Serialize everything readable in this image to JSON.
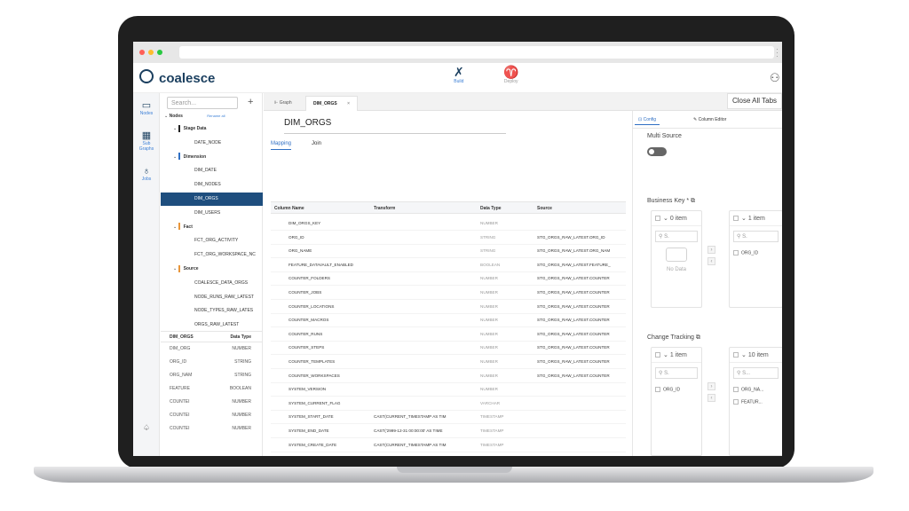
{
  "app": {
    "name": "coalesce"
  },
  "modes": [
    {
      "label": "Build",
      "icon": "build-icon"
    },
    {
      "label": "Deploy",
      "icon": "deploy-icon"
    }
  ],
  "rail": [
    {
      "label": "Nodes"
    },
    {
      "label": "Subgraphs",
      "label_line1": "Sub",
      "label_line2": "Graphs"
    },
    {
      "label": "Jobs"
    }
  ],
  "tree": {
    "search_placeholder": "Search...",
    "header": "Nodes",
    "header_hint": "Rename all",
    "items": [
      {
        "label": "Stage Data",
        "type": "group",
        "color": "#222222"
      },
      {
        "label": "DATE_NODE",
        "type": "node"
      },
      {
        "label": "Dimension",
        "type": "group",
        "color": "#2f6fc4"
      },
      {
        "label": "DIM_DATE",
        "type": "node"
      },
      {
        "label": "DIM_NODES",
        "type": "node"
      },
      {
        "label": "DIM_ORGS",
        "type": "node",
        "selected": true
      },
      {
        "label": "DIM_USERS",
        "type": "node"
      },
      {
        "label": "Fact",
        "type": "group",
        "color": "#e8963a"
      },
      {
        "label": "FCT_ORG_ACTIVITY",
        "type": "node"
      },
      {
        "label": "FCT_ORG_WORKSPACE_NC",
        "type": "node"
      },
      {
        "label": "Source",
        "type": "group",
        "color": "#e8963a"
      },
      {
        "label": "COALESCE_DATA_ORGS",
        "type": "node"
      },
      {
        "label": "NODE_RUNS_RAW_LATEST",
        "type": "node"
      },
      {
        "label": "NODE_TYPES_RAW_LATES",
        "type": "node"
      },
      {
        "label": "ORGS_RAW_LATEST",
        "type": "node"
      }
    ]
  },
  "mini_table": {
    "headers": [
      "DIM_ORGS",
      "Data Type"
    ],
    "rows": [
      [
        "DIM_ORG",
        "NUMBER"
      ],
      [
        "ORG_ID",
        "STRING"
      ],
      [
        "ORG_NAM",
        "STRING"
      ],
      [
        "FEATURE",
        "BOOLEAN"
      ],
      [
        "COUNTEI",
        "NUMBER"
      ],
      [
        "COUNTEI",
        "NUMBER"
      ],
      [
        "COUNTEI",
        "NUMBER"
      ]
    ]
  },
  "tabs": [
    {
      "label": "Graph"
    },
    {
      "label": "DIM_ORGS",
      "active": true,
      "close": "×"
    }
  ],
  "close_all_label": "Close All Tabs",
  "node": {
    "title": "DIM_ORGS"
  },
  "subtabs": [
    {
      "label": "Mapping",
      "active": true
    },
    {
      "label": "Join"
    }
  ],
  "grid": {
    "headers": [
      "Column Name",
      "Transform",
      "Data Type",
      "Source"
    ],
    "rows": [
      [
        "DIM_ORGS_KEY",
        "",
        "NUMBER",
        ""
      ],
      [
        "ORG_ID",
        "",
        "STRING",
        "STG_ORGS_RAW_LATEST.ORG_ID"
      ],
      [
        "ORG_NAME",
        "",
        "STRING",
        "STG_ORGS_RAW_LATEST.ORG_NAM"
      ],
      [
        "FEATURE_DATAVAULT_ENABLED",
        "",
        "BOOLEAN",
        "STG_ORGS_RAW_LATEST.FEATURE_"
      ],
      [
        "COUNTER_FOLDERS",
        "",
        "NUMBER",
        "STG_ORGS_RAW_LATEST.COUNTER"
      ],
      [
        "COUNTER_JOBS",
        "",
        "NUMBER",
        "STG_ORGS_RAW_LATEST.COUNTER"
      ],
      [
        "COUNTER_LOCATIONS",
        "",
        "NUMBER",
        "STG_ORGS_RAW_LATEST.COUNTER"
      ],
      [
        "COUNTER_MACROS",
        "",
        "NUMBER",
        "STG_ORGS_RAW_LATEST.COUNTER"
      ],
      [
        "COUNTER_RUNS",
        "",
        "NUMBER",
        "STG_ORGS_RAW_LATEST.COUNTER"
      ],
      [
        "COUNTER_STEPS",
        "",
        "NUMBER",
        "STG_ORGS_RAW_LATEST.COUNTER"
      ],
      [
        "COUNTER_TEMPLATES",
        "",
        "NUMBER",
        "STG_ORGS_RAW_LATEST.COUNTER"
      ],
      [
        "COUNTER_WORKSPACES",
        "",
        "NUMBER",
        "STG_ORGS_RAW_LATEST.COUNTER"
      ],
      [
        "SYSTEM_VERSION",
        "",
        "NUMBER",
        ""
      ],
      [
        "SYSTEM_CURRENT_FLAG",
        "",
        "VARCHAR",
        ""
      ],
      [
        "SYSTEM_START_DATE",
        "CAST(CURRENT_TIMESTAMP AS TIM",
        "TIMESTAMP",
        ""
      ],
      [
        "SYSTEM_END_DATE",
        "CAST('2999-12-31 00:00:00' AS TIME",
        "TIMESTAMP",
        ""
      ],
      [
        "SYSTEM_CREATE_DATE",
        "CAST(CURRENT_TIMESTAMP AS TIM",
        "TIMESTAMP",
        ""
      ],
      [
        "SYSTEM_UPDATE_DATE",
        "CAST(CURRENT_TIMESTAMP AS TIM",
        "TIMESTAMP",
        ""
      ]
    ],
    "placeholder_row": [
      "Column Name",
      "Transform",
      "Data Type",
      "Source"
    ]
  },
  "panel": {
    "tabs": [
      {
        "label": "Config",
        "active": true
      },
      {
        "label": "Column Editor"
      }
    ],
    "multi_source_label": "Multi Source",
    "business_key_label": "Business Key *",
    "business_key": {
      "left_header": "0 item",
      "right_header": "1 item",
      "search_placeholder": "S.",
      "left_empty": "No Data",
      "right_items": [
        "ORG_ID"
      ]
    },
    "change_tracking_label": "Change Tracking",
    "change_tracking": {
      "left_header": "1 item",
      "right_header": "10 item",
      "search_placeholder": "S.",
      "right_search_placeholder": "S...",
      "left_items": [
        "ORG_ID"
      ],
      "right_items": [
        "ORG_NA...",
        "FEATUR..."
      ]
    }
  },
  "colors": {
    "accent": "#2f6fc4",
    "selected_row": "#1e4e7e",
    "brand": "#1b3f5f"
  }
}
